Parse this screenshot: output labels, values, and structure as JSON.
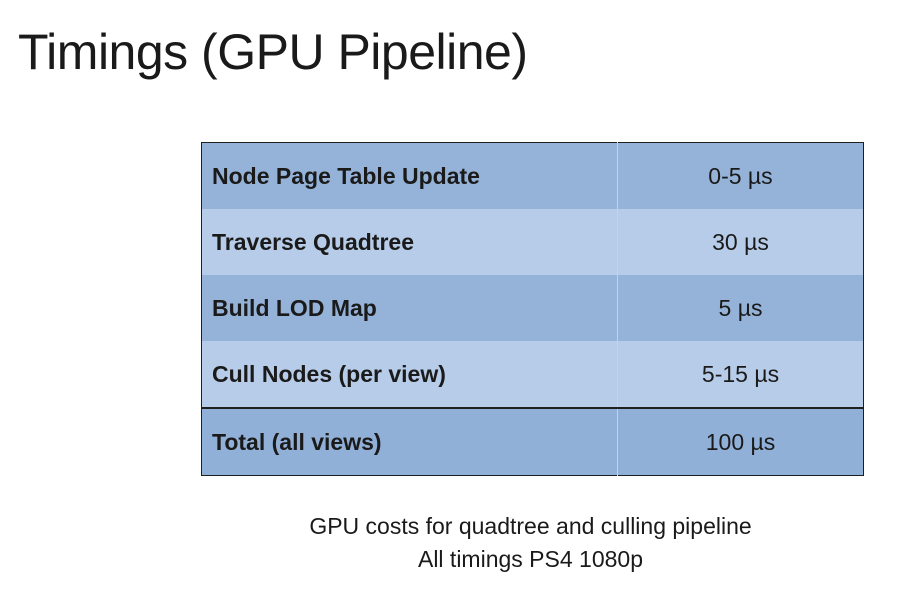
{
  "title": "Timings (GPU Pipeline)",
  "table": {
    "rows": [
      {
        "label": "Node Page Table Update",
        "value": "0-5 µs"
      },
      {
        "label": "Traverse Quadtree",
        "value": "30 µs"
      },
      {
        "label": "Build LOD Map",
        "value": "5 µs"
      },
      {
        "label": "Cull Nodes (per view)",
        "value": "5-15 µs"
      },
      {
        "label": "Total (all views)",
        "value": "100 µs"
      }
    ]
  },
  "caption": {
    "line1": "GPU costs for quadtree and culling pipeline",
    "line2": "All timings PS4 1080p"
  }
}
